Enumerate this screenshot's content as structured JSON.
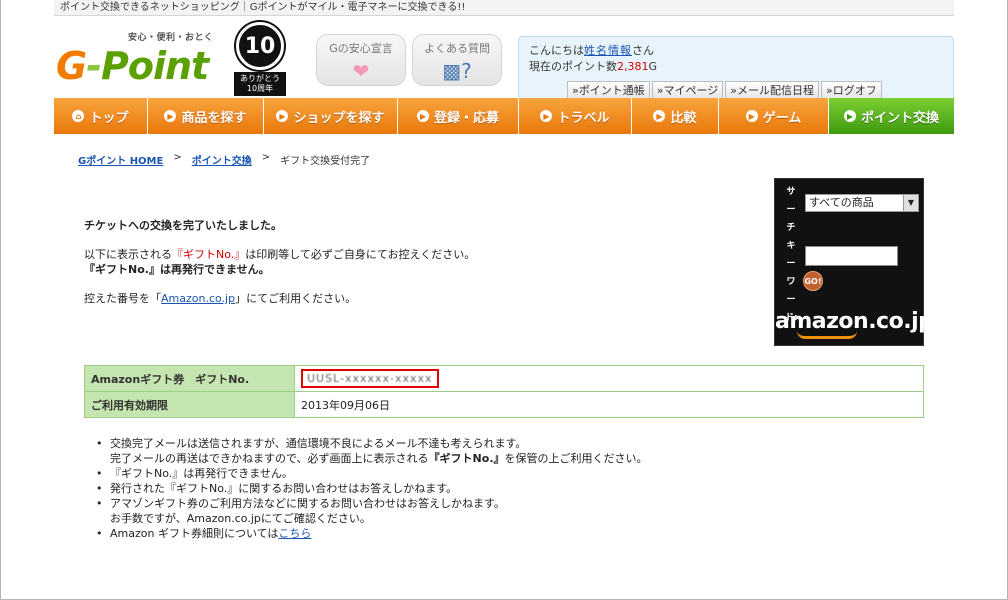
{
  "topbar": {
    "text": "ポイント交換できるネットショッピング｜Gポイントがマイル・電子マネーに交換できる!!"
  },
  "logo": {
    "tagline": "安心・便利・おとく",
    "g": "G",
    "dash": "-",
    "rest": "Point"
  },
  "anniversary": {
    "number": "10",
    "line1": "ありがとう",
    "line2": "10周年"
  },
  "links": {
    "security": "Gの安心宣言",
    "faq": "よくある質問"
  },
  "user": {
    "greeting_prefix": "こんにちは",
    "name": "姓名情報",
    "greeting_suffix": "さん",
    "points_prefix": "現在のポイント数",
    "points": "2,381",
    "points_unit": "G",
    "buttons": [
      "ポイント通帳",
      "マイページ",
      "メール配信日程",
      "ログオフ"
    ]
  },
  "nav": [
    {
      "label": "トップ",
      "icon": "home-icon"
    },
    {
      "label": "商品を探す",
      "icon": "arrow-circle-icon"
    },
    {
      "label": "ショップを探す",
      "icon": "arrow-circle-icon"
    },
    {
      "label": "登録・応募",
      "icon": "arrow-circle-icon"
    },
    {
      "label": "トラベル",
      "icon": "arrow-circle-icon"
    },
    {
      "label": "比較",
      "icon": "arrow-circle-icon"
    },
    {
      "label": "ゲーム",
      "icon": "arrow-circle-icon"
    },
    {
      "label": "ポイント交換",
      "icon": "arrow-circle-icon"
    }
  ],
  "breadcrumb": {
    "home": "Gポイント HOME",
    "sep": ">",
    "exchange": "ポイント交換",
    "current": "ギフト交換受付完了"
  },
  "message": {
    "title": "チケットへの交換を完了いたしました。",
    "line1_pre": "以下に表示される",
    "line1_red": "『ギフトNo.』",
    "line1_post": "は印刷等して必ずご自身にてお控えください。",
    "line2": "『ギフトNo.』は再発行できません。",
    "line3_pre": "控えた番号を「",
    "line3_link": "Amazon.co.jp",
    "line3_post": "」にてご利用ください。"
  },
  "amazon_search": {
    "label_chars": [
      "サ",
      "ー",
      "チ",
      ":",
      "キ",
      "ー",
      "ワ",
      "ー",
      "ド",
      ":"
    ],
    "category": "すべての商品",
    "go": "GO!",
    "logo": "amazon.co.jp"
  },
  "result": {
    "gift_label": "Amazonギフト券　ギフトNo.",
    "gift_code": "UUSL-xxxxxx-xxxxx",
    "expiry_label": "ご利用有効期限",
    "expiry_value": "2013年09月06日"
  },
  "notes": {
    "n1": "交換完了メールは送信されますが、通信環境不良によるメール不達も考えられます。",
    "n1b_pre": "完了メールの再送はできかねますので、必ず画面上に表示される",
    "n1b_bold": "『ギフトNo.』",
    "n1b_post": "を保管の上ご利用ください。",
    "n2": "『ギフトNo.』は再発行できません。",
    "n3": "発行された『ギフトNo.』に関するお問い合わせはお答えしかねます。",
    "n4": "アマゾンギフト券のご利用方法などに関するお問い合わせはお答えしかねます。",
    "n4b": "お手数ですが、Amazon.co.jpにてご確認ください。",
    "n5_pre": "Amazon ギフト券細則については",
    "n5_link": "こちら"
  }
}
